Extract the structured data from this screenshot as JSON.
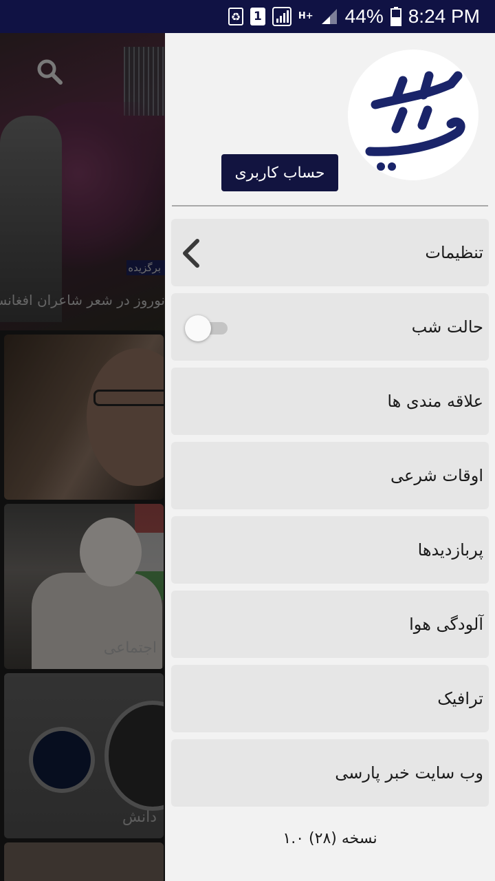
{
  "status_bar": {
    "sim_slot": "1",
    "network": "H+",
    "battery": "44%",
    "time": "8:24 PM"
  },
  "background": {
    "featured_tag": "برگزیده",
    "featured_title": "نوروز در شعر شاعران افغانستان",
    "card_labels": [
      "",
      "اجتماعی",
      "دانش",
      ""
    ]
  },
  "drawer": {
    "account_button": "حساب کاربری",
    "menu": [
      {
        "label": "تنظیمات",
        "accessory": "chevron-left-icon"
      },
      {
        "label": "حالت شب",
        "accessory": "toggle",
        "toggle_on": false
      },
      {
        "label": "علاقه مندی ها"
      },
      {
        "label": "اوقات شرعی"
      },
      {
        "label": "پربازدیدها"
      },
      {
        "label": "آلودگی هوا"
      },
      {
        "label": "ترافیک"
      },
      {
        "label": "وب سایت خبر پارسی"
      }
    ],
    "version": "نسخه (۲۸) ۱.۰"
  },
  "colors": {
    "status_bar": "#101244",
    "brand_navy": "#121440",
    "drawer_bg": "#f2f2f2",
    "menu_item_bg": "#e6e6e6"
  }
}
